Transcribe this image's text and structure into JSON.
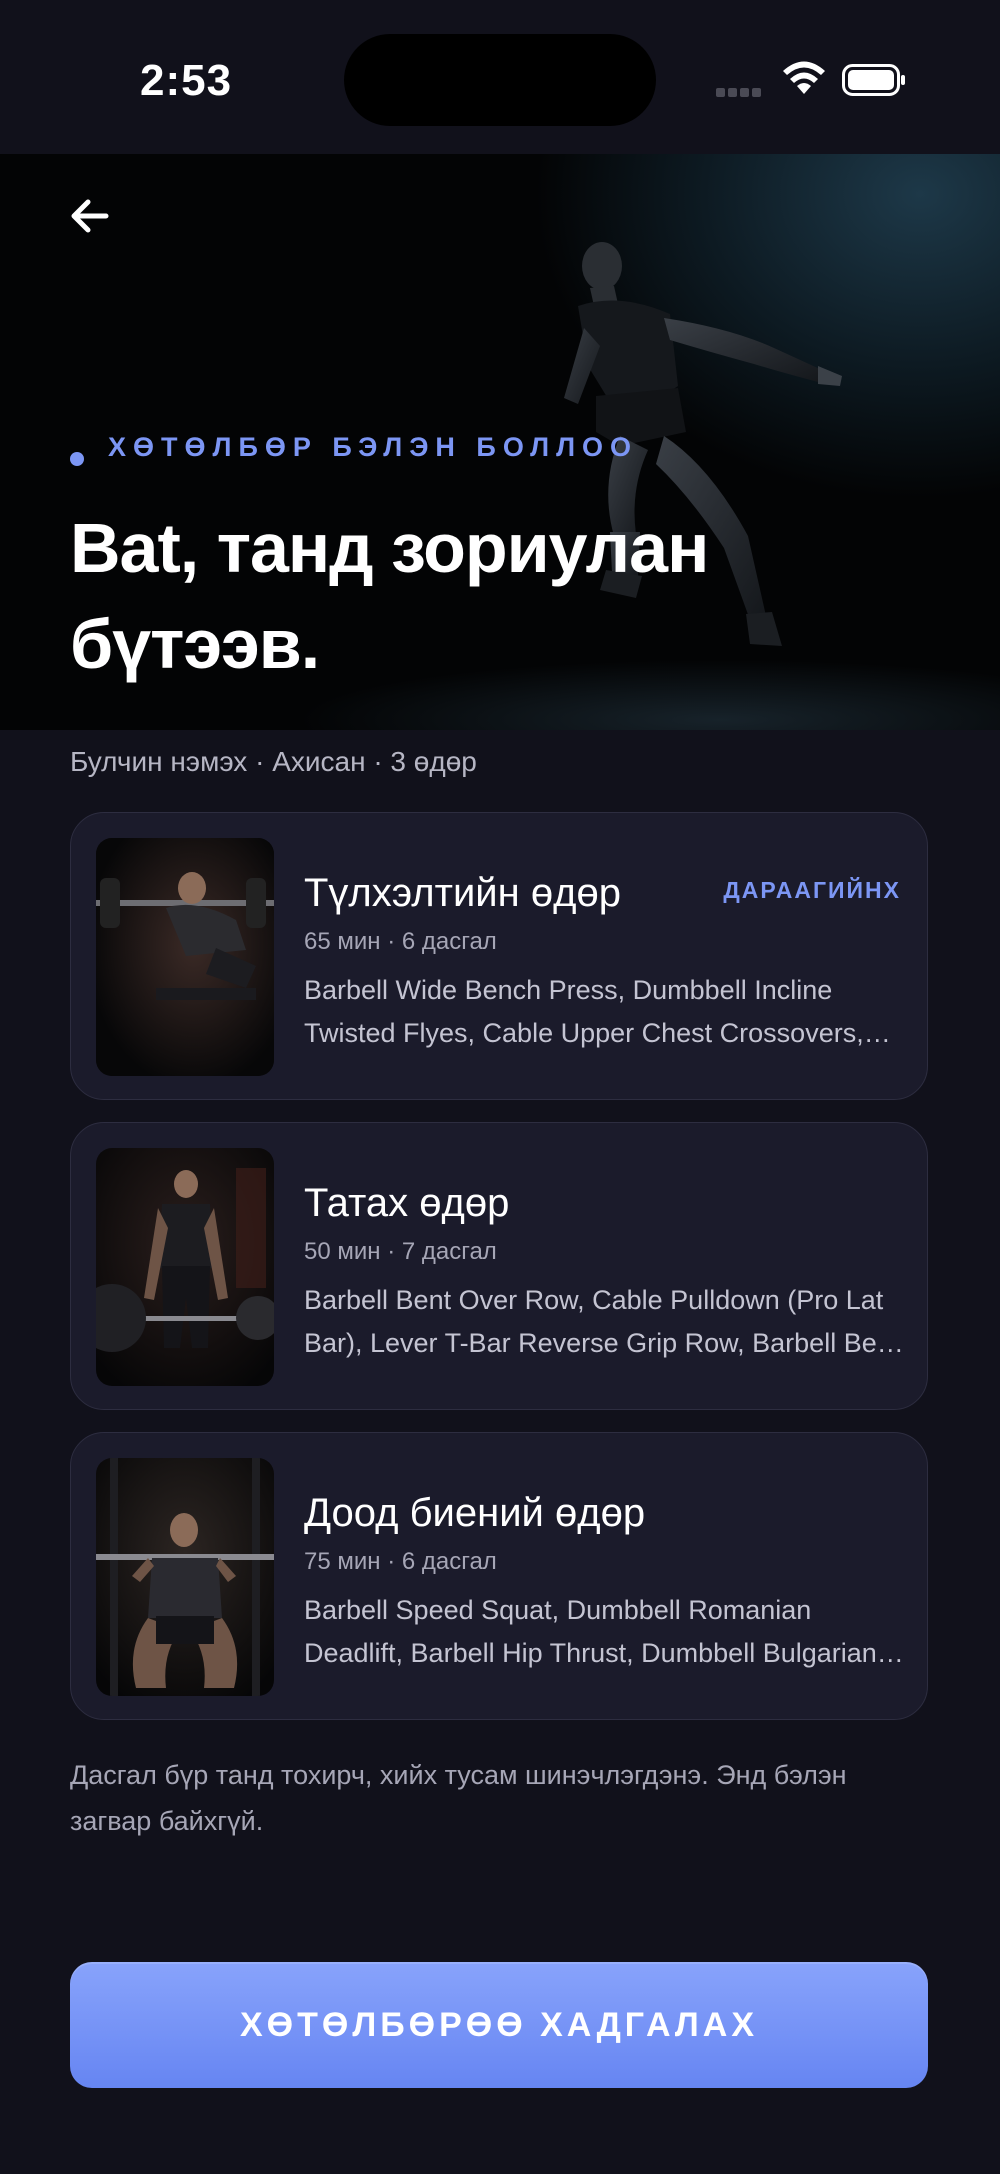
{
  "status_bar": {
    "time": "2:53"
  },
  "hero": {
    "eyebrow": "ХӨТӨЛБӨР БЭЛЭН БОЛЛОО",
    "headline": "Bat, танд зориулан бүтээв.",
    "summary": "Булчин нэмэх · Ахисан · 3 өдөр"
  },
  "workouts": [
    {
      "title": "Түлхэлтийн өдөр",
      "tag": "ДАРААГИЙНХ",
      "meta": "65 мин · 6 дасгал",
      "exercises": "Barbell Wide Bench Press, Dumbbell Incline Twisted Flyes, Cable Upper Chest Crossovers, Dumbbell Shoulder Press"
    },
    {
      "title": "Татах өдөр",
      "tag": "",
      "meta": "50 мин · 7 дасгал",
      "exercises": "Barbell Bent Over Row, Cable Pulldown (Pro Lat Bar), Lever T-Bar Reverse Grip Row, Barbell Bent Over Row"
    },
    {
      "title": "Доод биений өдөр",
      "tag": "",
      "meta": "75 мин · 6 дасгал",
      "exercises": "Barbell Speed Squat, Dumbbell Romanian Deadlift, Barbell Hip Thrust, Dumbbell Bulgarian Split Squat"
    }
  ],
  "footer_note": "Дасгал бүр танд тохирч, хийх тусам шинэчлэгдэнэ. Энд бэлэн загвар байхгүй.",
  "save_button": "ХӨТӨЛБӨРӨӨ ХАДГАЛАХ",
  "colors": {
    "accent": "#7c96f4",
    "background": "#11111b",
    "card": "#1b1b2b"
  },
  "icons": {
    "back": "arrow-left-icon",
    "wifi": "wifi-icon",
    "battery": "battery-icon",
    "signal": "cellular-signal-icon"
  }
}
